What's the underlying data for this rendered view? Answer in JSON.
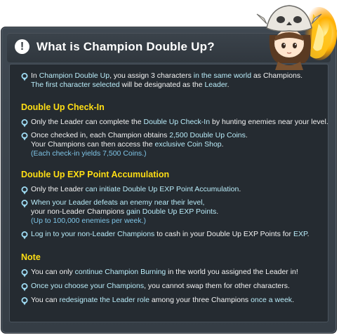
{
  "title": "What is Champion Double Up?",
  "title_icon": "exclamation-icon",
  "intro": {
    "p1": "In ",
    "h1": "Champion Double Up",
    "p2": ", you assign 3 characters ",
    "h2": "in the same world",
    "p3": " as Champions.",
    "h3": "The first character selected",
    "p4": " will be designated as the ",
    "h4": "Leader",
    "p5": "."
  },
  "checkin": {
    "heading": "Double Up Check-In",
    "b1": {
      "p1": "Only the Leader can complete the ",
      "h1": "Double Up Check-In",
      "p2": " by hunting enemies near your level."
    },
    "b2": {
      "p1": "Once checked in, each Champion obtains ",
      "h1": "2,500 Double Up Coins",
      "p2": ".",
      "p3": "Your Champions can then access the ",
      "h2": "exclusive Coin Shop",
      "p4": ".",
      "sub": "(Each check-in yields 7,500 Coins.)"
    }
  },
  "exp": {
    "heading": "Double Up EXP Point Accumulation",
    "b1": {
      "p1": "Only the Leader ",
      "h1": "can initiate Double Up EXP Point Accumulation",
      "p2": "."
    },
    "b2": {
      "h1": "When your Leader defeats an enemy near their level,",
      "p1": "your non-Leader Champions ",
      "h2": "gain Double Up EXP Points",
      "p2": ".",
      "sub": "(Up to 100,000 enemies per week.)"
    },
    "b3": {
      "h1": "Log in to your non-Leader Champions",
      "p1": " to cash in your Double Up EXP Points for ",
      "h2": "EXP",
      "p2": "."
    }
  },
  "note": {
    "heading": "Note",
    "b1": {
      "p1": "You can only ",
      "h1": "continue Champion Burning",
      "p2": " in the world you assigned the Leader in!"
    },
    "b2": {
      "h1": "Once you choose your Champions",
      "p1": ", you cannot swap them for other characters."
    },
    "b3": {
      "p1": "You can ",
      "h1": "redesignate the Leader role",
      "p2": " among your three Champions ",
      "h2": "once a week",
      "p3": "."
    }
  },
  "colors": {
    "heading": "#ffde14",
    "highlight": "#b9ecf9",
    "subnote": "#7fc4e6",
    "body": "#f2f2f2"
  }
}
